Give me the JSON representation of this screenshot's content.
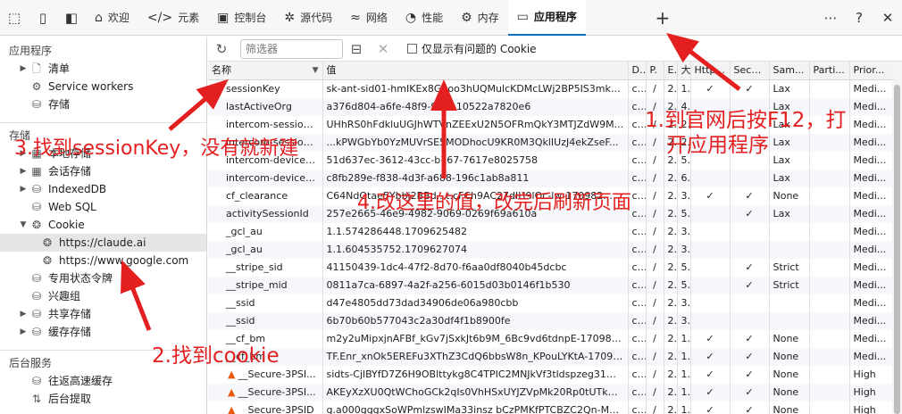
{
  "tabs": [
    {
      "label": "欢迎",
      "icon": "home-icon",
      "glyph": "⌂"
    },
    {
      "label": "元素",
      "icon": "code-icon",
      "glyph": "</>"
    },
    {
      "label": "控制台",
      "icon": "console-icon",
      "glyph": "▣"
    },
    {
      "label": "源代码",
      "icon": "bug-icon",
      "glyph": "✲"
    },
    {
      "label": "网络",
      "icon": "wifi-icon",
      "glyph": "≈"
    },
    {
      "label": "性能",
      "icon": "gauge-icon",
      "glyph": "◔"
    },
    {
      "label": "内存",
      "icon": "memory-chip-icon",
      "glyph": "⚙"
    },
    {
      "label": "应用程序",
      "icon": "application-icon",
      "glyph": "▭",
      "active": true
    }
  ],
  "sidebar": {
    "section_app": "应用程序",
    "manifest": "清单",
    "service_workers": "Service workers",
    "storage": "存储",
    "section_storage": "存储",
    "local_storage": "本地存储",
    "session_storage": "会话存储",
    "indexeddb": "IndexedDB",
    "websql": "Web SQL",
    "cookie": "Cookie",
    "cookie_claude": "https://claude.ai",
    "cookie_google": "https://www.google.com",
    "private_state": "专用状态令牌",
    "interest_groups": "兴趣组",
    "shared_storage": "共享存储",
    "cache_storage": "缓存存储",
    "section_background": "后台服务",
    "bfcache": "往返高速缓存",
    "background_fetch": "后台提取"
  },
  "toolbar": {
    "filter_placeholder": "筛选器",
    "only_issues_label": "仅显示有问题的 Cookie"
  },
  "table": {
    "columns": [
      "名称",
      "值",
      "D.",
      "P.",
      "E.",
      "大",
      "Http...",
      "Secure",
      "Sam...",
      "Parti...",
      "Prior..."
    ],
    "rows": [
      [
        "sessionKey",
        "sk-ant-sid01-hmIKEx8Ggoo3hUQMulcKDMcLWj2BP5IS3mk_y...",
        "c...",
        "/",
        "2...",
        "1",
        "✓",
        "✓",
        "Lax",
        "",
        "Medi..."
      ],
      [
        "lastActiveOrg",
        "a376d804-a6fe-48f9-94...-10522a7820e6",
        "c...",
        "/",
        "2...",
        "4",
        "",
        "",
        "Lax",
        "",
        "Medi..."
      ],
      [
        "intercom-session...",
        "UHhRS0hFdkluUGJhWTVnZEExU2N5OFRmQkY3MTJZdW9M...",
        "c...",
        "/",
        "2...",
        "2",
        "",
        "",
        "Lax",
        "",
        "Medi..."
      ],
      [
        "intercom-session...",
        "...kPWGbYb0YzMUVrSE5MODhocU9KR0M3QklIUzJ4ekZseF...",
        "c...",
        "/",
        "2...",
        "2",
        "",
        "",
        "Lax",
        "",
        "Medi..."
      ],
      [
        "intercom-device-i...",
        "51d637ec-3612-43cc-b767-7617e8025758",
        "c...",
        "/",
        "2...",
        "5",
        "",
        "",
        "Lax",
        "",
        "Medi..."
      ],
      [
        "intercom-device-i...",
        "c8fb289e-f838-4d3f-a688-196c1ab8a811",
        "c...",
        "/",
        "2...",
        "6",
        "",
        "",
        "Lax",
        "",
        "Medi..."
      ],
      [
        "cf_clearance",
        "C64NdOtae5Ybbj2BBd...t.cFCh9AC27dIH9lOc-lw-170982...",
        "c...",
        "/",
        "2...",
        "3",
        "✓",
        "✓",
        "None",
        "",
        "Medi..."
      ],
      [
        "activitySessionId",
        "257e2665-46e9-4982-9069-0269f69a610a",
        "c...",
        "/",
        "2...",
        "5",
        "",
        "✓",
        "Lax",
        "",
        "Medi..."
      ],
      [
        "_gcl_au",
        "1.1.574286448.1709625482",
        "c...",
        "/",
        "2...",
        "3",
        "",
        "",
        "",
        "",
        "Medi..."
      ],
      [
        "_gcl_au",
        "1.1.604535752.1709627074",
        "c...",
        "/",
        "2...",
        "3",
        "",
        "",
        "",
        "",
        "Medi..."
      ],
      [
        "__stripe_sid",
        "41150439-1dc4-47f2-8d70-f6aa0df8040b45dcbc",
        "c...",
        "/",
        "2...",
        "5",
        "",
        "✓",
        "Strict",
        "",
        "Medi..."
      ],
      [
        "__stripe_mid",
        "0811a7ca-6897-4a2f-a256-6015d03b0146f1b530",
        "c...",
        "/",
        "2...",
        "5",
        "",
        "✓",
        "Strict",
        "",
        "Medi..."
      ],
      [
        "__ssid",
        "d47e4805dd73dad34906de06a980cbb",
        "c...",
        "/",
        "2...",
        "3",
        "",
        "",
        "",
        "",
        "Medi..."
      ],
      [
        "__ssid",
        "6b70b60b577043c2a30df4f1b8900fe",
        "c...",
        "/",
        "2...",
        "3",
        "",
        "",
        "",
        "",
        "Medi..."
      ],
      [
        "__cf_bm",
        "m2y2uMipxjnAFBf_kGv7jSxkJt6b9M_6Bc9vd6tdnpE-1709820...",
        "c...",
        "/",
        "2...",
        "1",
        "✓",
        "✓",
        "None",
        "",
        "Medi..."
      ],
      [
        "__cf_bm",
        "TF.Enr_xnOk5EREFu3XThZ3CdQ6bbsW8n_KPouLYKtA-170982...",
        "c...",
        "/",
        "2...",
        "1",
        "✓",
        "✓",
        "None",
        "",
        "Medi..."
      ],
      [
        "__Secure-3PSI...",
        "sidts-CjlBYfD7Z6H9OBlttykg8C4TPIC2MNJkVf3tldspzeg31w1...",
        "c...",
        "/",
        "2...",
        "1",
        "✓",
        "✓",
        "None",
        "",
        "High"
      ],
      [
        "__Secure-3PSI...",
        "AKEyXzXU0QtWChoGCk2qIs0VhHSxUYJZVpMk20Rp0tUTkKs...",
        "c...",
        "/",
        "2...",
        "1",
        "✓",
        "✓",
        "None",
        "",
        "High"
      ],
      [
        "__Secure-3PSID",
        "g.a000gggxSoWPmlzswIMa33insz bCzPMKfPTCBZC2Qn-MA-...",
        "c...",
        "/",
        "2...",
        "1",
        "✓",
        "✓",
        "None",
        "",
        "High"
      ]
    ],
    "warn_rows": [
      16,
      17,
      18
    ]
  },
  "annotations": {
    "step1": "1.到官网后按F12，打",
    "step1b": "开应用程序",
    "step2": "2.找到cookie",
    "step3": "3.找到sessionKey，没有就新建",
    "step4": "4.改这里的值，改完后刷新页面"
  },
  "colors": {
    "annotation": "#e41f1f",
    "accent": "#0f6cbd"
  }
}
